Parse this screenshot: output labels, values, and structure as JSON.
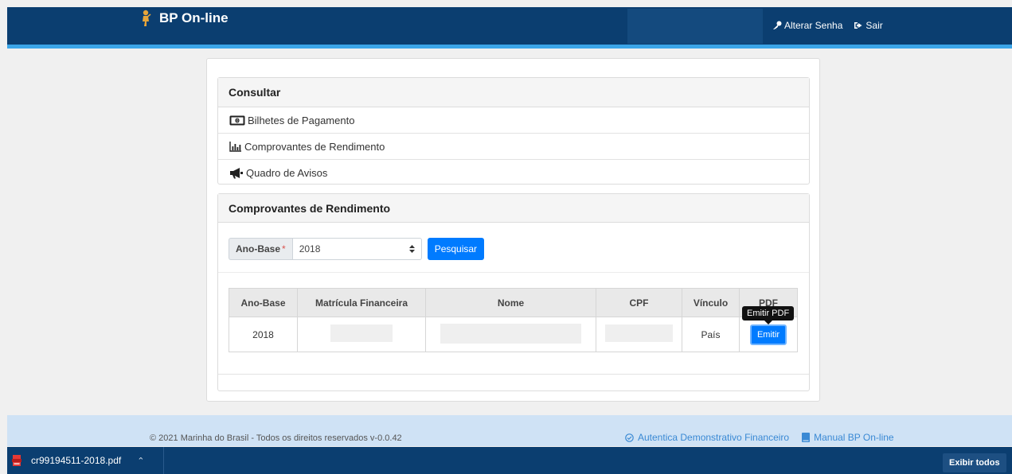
{
  "navbar": {
    "brand": "BP On-line",
    "change_password": "Alterar Senha",
    "logout": "Sair"
  },
  "consultar": {
    "title": "Consultar",
    "items": [
      {
        "label": "Bilhetes de Pagamento",
        "icon": "money-bill-icon"
      },
      {
        "label": "Comprovantes de Rendimento",
        "icon": "bar-chart-icon"
      },
      {
        "label": "Quadro de Avisos",
        "icon": "megaphone-icon"
      }
    ]
  },
  "comprovantes": {
    "title": "Comprovantes de Rendimento",
    "filter_label": "Ano-Base",
    "required_mark": "*",
    "selected_year": "2018",
    "search_button": "Pesquisar",
    "table": {
      "headers": [
        "Ano-Base",
        "Matrícula Financeira",
        "Nome",
        "CPF",
        "Vínculo",
        "PDF"
      ],
      "rows": [
        {
          "ano_base": "2018",
          "matricula": "",
          "nome": "",
          "cpf": "",
          "vinculo": "País",
          "action": "Emitir"
        }
      ]
    },
    "tooltip": "Emitir PDF"
  },
  "footer": {
    "copyright": "© 2021 Marinha do Brasil - Todos os direitos reservados v-0.0.42",
    "link_authenticate": "Autentica Demonstrativo Financeiro",
    "link_manual": "Manual BP On-line"
  },
  "download_bar": {
    "file_name": "cr99194511-2018.pdf",
    "show_all": "Exibir todos"
  },
  "colors": {
    "navbar": "#0b3e70",
    "accent_stripe": "#3ba5e8",
    "primary_button": "#007bff",
    "footer": "#cfe2f5",
    "link": "#3a89d4"
  }
}
